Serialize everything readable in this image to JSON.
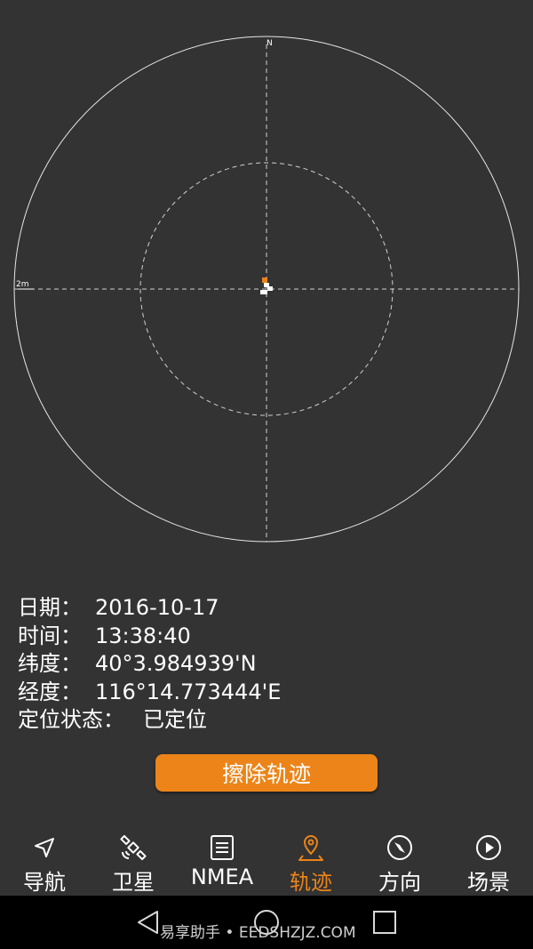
{
  "radar": {
    "north_label": "N",
    "scale_label": "2m"
  },
  "info": {
    "date_label": "日期：",
    "date_value": "2016-10-17",
    "time_label": "时间：",
    "time_value": "13:38:40",
    "lat_label": "纬度：",
    "lat_value": "40°3.984939'N",
    "lon_label": "经度：",
    "lon_value": "116°14.773444'E",
    "status_label": "定位状态：",
    "status_value": "已定位"
  },
  "clear_button_label": "擦除轨迹",
  "tabs": [
    {
      "label": "导航",
      "icon": "navigation-arrow-icon"
    },
    {
      "label": "卫星",
      "icon": "satellite-icon"
    },
    {
      "label": "NMEA",
      "icon": "document-lines-icon"
    },
    {
      "label": "轨迹",
      "icon": "location-pin-icon"
    },
    {
      "label": "方向",
      "icon": "compass-icon"
    },
    {
      "label": "场景",
      "icon": "play-circle-icon"
    }
  ],
  "active_tab": 3,
  "watermark": "易享助手 • EEDSHZJZ.COM",
  "colors": {
    "background": "#333333",
    "accent": "#ec8419",
    "text": "#ffffff",
    "navbar": "#000000"
  }
}
